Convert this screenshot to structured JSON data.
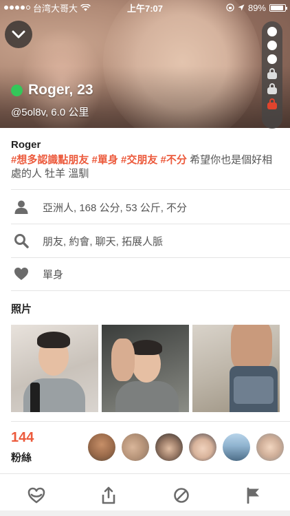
{
  "status_bar": {
    "carrier": "台湾大哥大",
    "time": "上午7:07",
    "battery": "89%",
    "battery_level": 0.89
  },
  "hero": {
    "name_age": "Roger, 23",
    "handle_distance": "@5ol8v, 6.0 公里",
    "online": true,
    "photo_slots": [
      "dot",
      "dot",
      "dot",
      "lock",
      "lock",
      "lock-red"
    ]
  },
  "profile": {
    "username": "Roger",
    "tags": [
      "#想多認識點朋友",
      "#單身",
      "#交朋友",
      "#不分"
    ],
    "bio_text": "希望你也是個好相處的人 牡羊 溫馴"
  },
  "info": {
    "body": "亞洲人, 168 公分, 53 公斤, 不分",
    "looking_for": "朋友, 約會, 聊天, 拓展人脈",
    "relationship": "單身"
  },
  "photos_section": {
    "title": "照片"
  },
  "fans": {
    "count": "144",
    "label": "粉絲"
  },
  "icons": {
    "collapse": "chevron-down-icon",
    "body": "person-icon",
    "looking_for": "search-icon",
    "relationship": "heart-icon",
    "favorite": "heart-outline-icon",
    "share": "share-icon",
    "block": "block-icon",
    "report": "flag-icon"
  },
  "colors": {
    "accent": "#ec5a3c",
    "online": "#34c759",
    "icon_gray": "#6b6b6b"
  }
}
